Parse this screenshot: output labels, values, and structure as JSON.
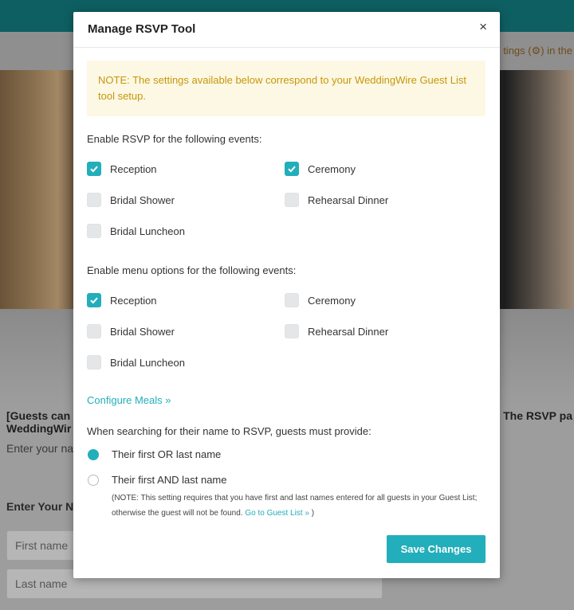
{
  "background": {
    "notice_fragment": "tings (⚙) in the",
    "left_heading_line1": "[Guests can",
    "left_heading_line2": "WeddingWir",
    "left_subtext": "Enter your na",
    "left_enter_heading": "Enter Your N",
    "first_name_placeholder": "First name",
    "last_name_placeholder": "Last name",
    "right_heading": "The RSVP pa"
  },
  "modal": {
    "title": "Manage RSVP Tool",
    "close_label": "×",
    "note": "NOTE: The settings available below correspond to your WeddingWire Guest List tool setup.",
    "rsvp_section_label": "Enable RSVP for the following events:",
    "rsvp_events": [
      {
        "label": "Reception",
        "checked": true
      },
      {
        "label": "Ceremony",
        "checked": true
      },
      {
        "label": "Bridal Shower",
        "checked": false
      },
      {
        "label": "Rehearsal Dinner",
        "checked": false
      },
      {
        "label": "Bridal Luncheon",
        "checked": false
      }
    ],
    "menu_section_label": "Enable menu options for the following events:",
    "menu_events": [
      {
        "label": "Reception",
        "checked": true
      },
      {
        "label": "Ceremony",
        "checked": false
      },
      {
        "label": "Bridal Shower",
        "checked": false
      },
      {
        "label": "Rehearsal Dinner",
        "checked": false
      },
      {
        "label": "Bridal Luncheon",
        "checked": false
      }
    ],
    "configure_meals_link": "Configure Meals »",
    "search_section_label": "When searching for their name to RSVP, guests must provide:",
    "search_options": [
      {
        "label": "Their first OR last name",
        "selected": true
      },
      {
        "label": "Their first AND last name",
        "selected": false
      }
    ],
    "small_note_text": "(NOTE: This setting requires that you have first and last names entered for all guests in your Guest List; otherwise the guest will not be found.",
    "small_note_link": "Go to Guest List »",
    "small_note_end": ")",
    "save_button": "Save Changes"
  },
  "colors": {
    "accent": "#22aebb",
    "note_text": "#c6970a",
    "note_bg": "#fdf8e4"
  }
}
